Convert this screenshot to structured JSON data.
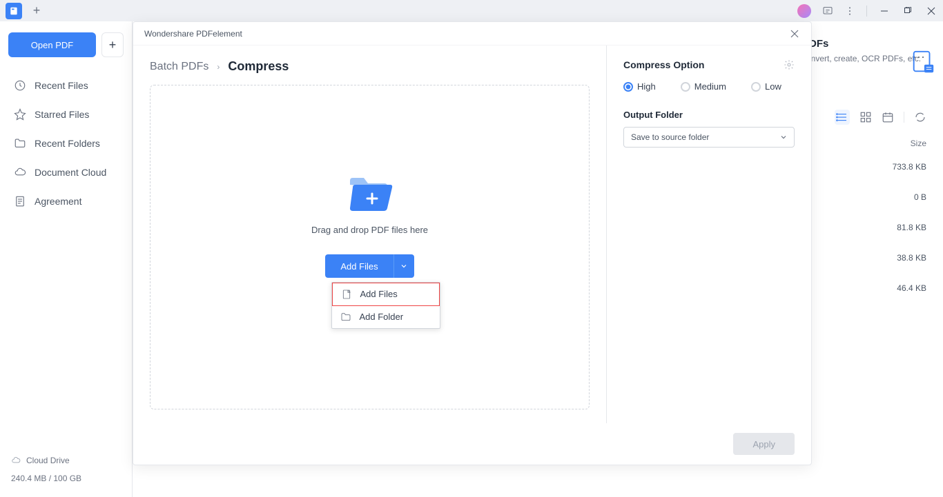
{
  "titlebar": {
    "logo_letter": ""
  },
  "sidebar": {
    "open_pdf": "Open PDF",
    "items": [
      {
        "label": "Recent Files"
      },
      {
        "label": "Starred Files"
      },
      {
        "label": "Recent Folders"
      },
      {
        "label": "Document Cloud"
      },
      {
        "label": "Agreement"
      }
    ],
    "cloud_drive": "Cloud Drive",
    "storage": "240.4 MB / 100 GB"
  },
  "content_peek": {
    "title": "PDFs",
    "desc": "convert, create, OCR PDFs, etc.",
    "col_size": "Size",
    "sizes": [
      "733.8 KB",
      "0 B",
      "81.8 KB",
      "38.8 KB",
      "46.4 KB"
    ]
  },
  "modal": {
    "title": "Wondershare PDFelement",
    "breadcrumb": {
      "parent": "Batch PDFs",
      "current": "Compress"
    },
    "dropzone": {
      "text": "Drag and drop PDF files here",
      "add_files_btn": "Add Files",
      "menu": {
        "add_files": "Add Files",
        "add_folder": "Add Folder"
      }
    },
    "options": {
      "title": "Compress Option",
      "radios": {
        "high": "High",
        "medium": "Medium",
        "low": "Low"
      },
      "output_label": "Output Folder",
      "output_value": "Save to source folder"
    },
    "apply": "Apply"
  }
}
